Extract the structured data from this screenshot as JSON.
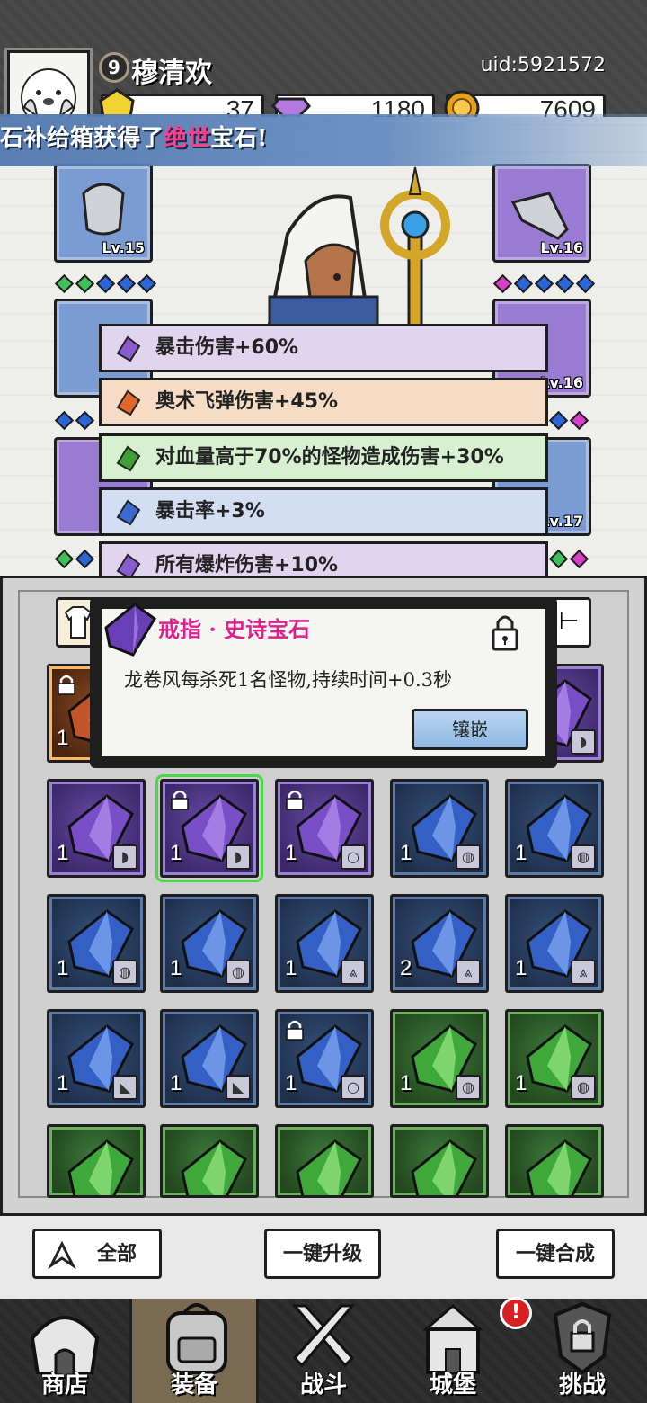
{
  "player": {
    "level": "9",
    "name": "穆清欢",
    "uid": "uid:5921572"
  },
  "currencies": [
    {
      "icon": "gold-crystal-icon",
      "value": "37",
      "color": "#f2d230"
    },
    {
      "icon": "purple-diamond-icon",
      "value": "1180",
      "color": "#a56bd8"
    },
    {
      "icon": "gold-coin-icon",
      "value": "7609",
      "color": "#e6a21a"
    }
  ],
  "banner": {
    "prefix": "石补给箱获得了",
    "highlight": "绝世",
    "suffix": "宝石!"
  },
  "equipment": [
    {
      "icon": "helmet-icon",
      "level": "Lv.15",
      "rarity": "blue"
    },
    {
      "icon": "gloves-icon",
      "level": "Lv.16",
      "rarity": "purple"
    },
    {
      "icon": "armor-icon",
      "level": "",
      "rarity": "blue"
    },
    {
      "icon": "necklace-icon",
      "level": "Lv.16",
      "rarity": "purple"
    },
    {
      "icon": "boots-icon",
      "level": "",
      "rarity": "purple"
    },
    {
      "icon": "ring-icon",
      "level": "Lv.17",
      "rarity": "blue"
    }
  ],
  "affixes": [
    {
      "text": "暴击伤害+60%",
      "gem": "purple-gem-icon",
      "bg": "#e0d4ef",
      "gemcolor": "#8a5cd0"
    },
    {
      "text": "奥术飞弹伤害+45%",
      "gem": "orange-gem-icon",
      "bg": "#f6dcc4",
      "gemcolor": "#e0662a"
    },
    {
      "text": "对血量高于70%的怪物造成伤害+30%",
      "gem": "green-gem-icon",
      "bg": "#d6f0d0",
      "gemcolor": "#3fa03a"
    },
    {
      "text": "暴击率+3%",
      "gem": "blue-gem-icon",
      "bg": "#d4def2",
      "gemcolor": "#3a6ad0"
    },
    {
      "text": "所有爆炸伤害+10%",
      "gem": "purple-gem-icon",
      "bg": "#e0d4ef",
      "gemcolor": "#8a5cd0"
    }
  ],
  "tooltip": {
    "title": "戒指 · 史诗宝石",
    "description": "龙卷风每杀死1名怪物,持续时间+0.3秒",
    "button": "镶嵌",
    "locked": true
  },
  "inventory_rows": [
    [
      {
        "rarity": "orange",
        "qty": "1",
        "locked": true,
        "type": "",
        "visible": true
      },
      {
        "rarity": "none",
        "qty": "",
        "locked": false,
        "type": "",
        "visible": false
      },
      {
        "rarity": "none",
        "qty": "",
        "locked": false,
        "type": "",
        "visible": false
      },
      {
        "rarity": "none",
        "qty": "",
        "locked": false,
        "type": "",
        "visible": false
      },
      {
        "rarity": "purple",
        "qty": "",
        "locked": false,
        "type": "glove-type-icon",
        "visible": true
      }
    ],
    [
      {
        "rarity": "purple",
        "qty": "1",
        "locked": false,
        "type": "glove-type-icon",
        "visible": true
      },
      {
        "rarity": "purple",
        "qty": "1",
        "locked": true,
        "type": "glove-type-icon",
        "visible": true,
        "selected": true
      },
      {
        "rarity": "purple",
        "qty": "1",
        "locked": true,
        "type": "ring-type-icon",
        "visible": true
      },
      {
        "rarity": "blue",
        "qty": "1",
        "locked": false,
        "type": "helmet-type-icon",
        "visible": true
      },
      {
        "rarity": "blue",
        "qty": "1",
        "locked": false,
        "type": "helmet-type-icon",
        "visible": true
      }
    ],
    [
      {
        "rarity": "blue",
        "qty": "1",
        "locked": false,
        "type": "helmet-type-icon",
        "visible": true
      },
      {
        "rarity": "blue",
        "qty": "1",
        "locked": false,
        "type": "helmet-type-icon",
        "visible": true
      },
      {
        "rarity": "blue",
        "qty": "1",
        "locked": false,
        "type": "armor-type-icon",
        "visible": true
      },
      {
        "rarity": "blue",
        "qty": "2",
        "locked": false,
        "type": "armor-type-icon",
        "visible": true
      },
      {
        "rarity": "blue",
        "qty": "1",
        "locked": false,
        "type": "armor-type-icon",
        "visible": true
      }
    ],
    [
      {
        "rarity": "blue",
        "qty": "1",
        "locked": false,
        "type": "boots-type-icon",
        "visible": true
      },
      {
        "rarity": "blue",
        "qty": "1",
        "locked": false,
        "type": "boots-type-icon",
        "visible": true
      },
      {
        "rarity": "blue",
        "qty": "1",
        "locked": true,
        "type": "ring-type-icon",
        "visible": true
      },
      {
        "rarity": "green",
        "qty": "1",
        "locked": false,
        "type": "helmet-type-icon",
        "visible": true
      },
      {
        "rarity": "green",
        "qty": "1",
        "locked": false,
        "type": "helmet-type-icon",
        "visible": true
      }
    ],
    [
      {
        "rarity": "green",
        "qty": "",
        "locked": false,
        "type": "",
        "visible": true
      },
      {
        "rarity": "green",
        "qty": "",
        "locked": false,
        "type": "",
        "visible": true
      },
      {
        "rarity": "green",
        "qty": "",
        "locked": false,
        "type": "",
        "visible": true
      },
      {
        "rarity": "green",
        "qty": "",
        "locked": false,
        "type": "",
        "visible": true
      },
      {
        "rarity": "green",
        "qty": "",
        "locked": false,
        "type": "",
        "visible": true
      }
    ]
  ],
  "actions": {
    "filter": "全部",
    "upgrade_all": "一键升级",
    "merge_all": "一键合成"
  },
  "nav": [
    {
      "label": "商店",
      "icon": "shop-icon",
      "active": false
    },
    {
      "label": "装备",
      "icon": "backpack-icon",
      "active": true
    },
    {
      "label": "战斗",
      "icon": "crossed-swords-icon",
      "active": false
    },
    {
      "label": "城堡",
      "icon": "castle-icon",
      "active": false,
      "alert": "!"
    },
    {
      "label": "挑战",
      "icon": "locked-shield-icon",
      "active": false
    }
  ]
}
